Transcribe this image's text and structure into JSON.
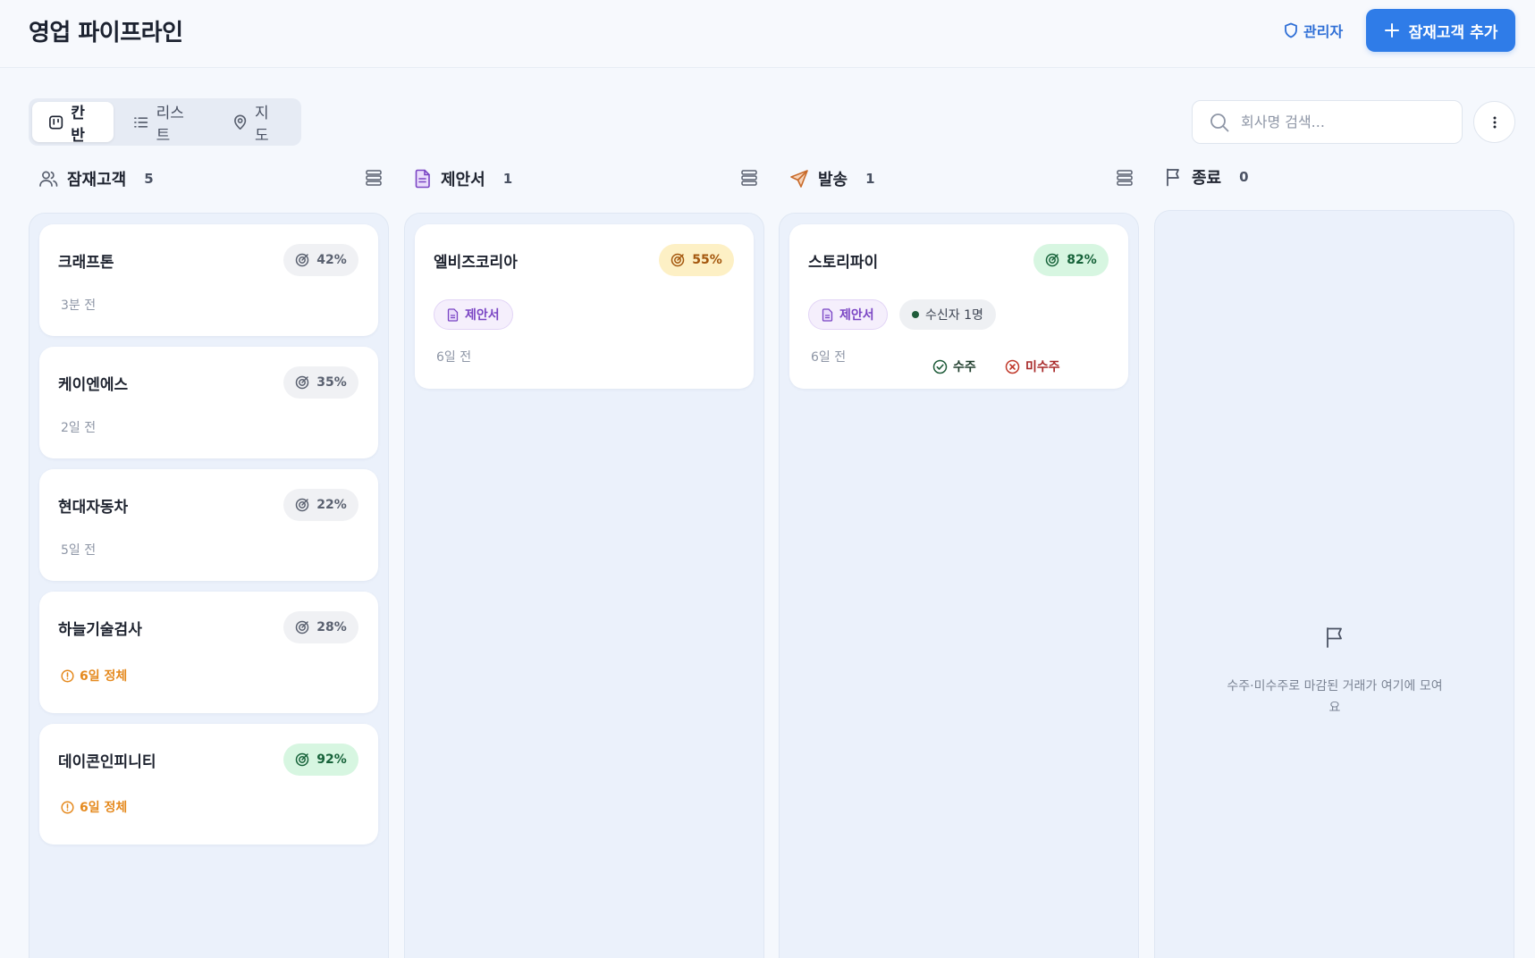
{
  "header": {
    "title": "영업 파이프라인",
    "admin_label": "관리자",
    "add_button_label": "잠재고객 추가"
  },
  "view_tabs": [
    {
      "label": "칸반",
      "icon": "kanban-icon",
      "active": true
    },
    {
      "label": "리스트",
      "icon": "list-icon",
      "active": false
    },
    {
      "label": "지도",
      "icon": "map-pin-icon",
      "active": false
    }
  ],
  "search": {
    "placeholder": "회사명 검색...",
    "value": ""
  },
  "columns": [
    {
      "title": "잠재고객",
      "count": "5",
      "icon": "users-icon",
      "icon_color": "#5a6170",
      "cards": [
        {
          "name": "크래프톤",
          "probability": "42%",
          "badge": "gray",
          "time": "3분 전"
        },
        {
          "name": "케이엔에스",
          "probability": "35%",
          "badge": "gray",
          "time": "2일 전"
        },
        {
          "name": "현대자동차",
          "probability": "22%",
          "badge": "gray",
          "time": "5일 전"
        },
        {
          "name": "하늘기술검사",
          "probability": "28%",
          "badge": "gray",
          "stale": "6일 정체"
        },
        {
          "name": "데이콘인피니티",
          "probability": "92%",
          "badge": "green",
          "stale": "6일 정체"
        }
      ]
    },
    {
      "title": "제안서",
      "count": "1",
      "icon": "document-icon",
      "icon_color": "#7a45c4",
      "cards": [
        {
          "name": "엘비즈코리아",
          "probability": "55%",
          "badge": "yellow",
          "tag": "제안서",
          "time": "6일 전"
        }
      ]
    },
    {
      "title": "발송",
      "count": "1",
      "icon": "send-icon",
      "icon_color": "#c86a2a",
      "cards": [
        {
          "name": "스토리파이",
          "probability": "82%",
          "badge": "green",
          "tag": "제안서",
          "recipients": "수신자 1명",
          "time": "6일 전",
          "won_label": "수주",
          "lost_label": "미수주"
        }
      ]
    },
    {
      "title": "종료",
      "count": "0",
      "icon": "flag-icon",
      "icon_color": "#4a5263",
      "empty_text": "수주·미수주로 마감된 거래가 여기에 모여요"
    }
  ],
  "colors": {
    "primary": "#2f7ce8",
    "won": "#1f7a45",
    "lost": "#c0392b",
    "stale": "#e58a1f"
  }
}
